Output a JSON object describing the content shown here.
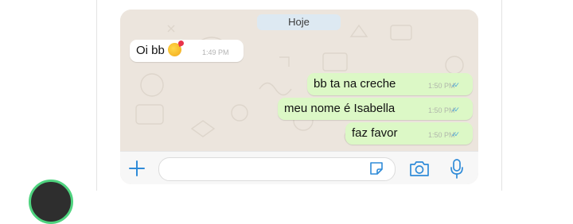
{
  "chat": {
    "date_separator": "Hoje",
    "messages": [
      {
        "direction": "incoming",
        "text": "Oi bb",
        "emoji": "smiling-face-with-hearts",
        "time": "1:49 PM",
        "read": false
      },
      {
        "direction": "outgoing",
        "text": "bb ta na creche",
        "time": "1:50 PM",
        "read": true
      },
      {
        "direction": "outgoing",
        "text": "meu nome é Isabella",
        "time": "1:50 PM",
        "read": true
      },
      {
        "direction": "outgoing",
        "text": "faz favor",
        "time": "1:50 PM",
        "read": true
      }
    ]
  },
  "composer": {
    "value": "",
    "placeholder": "",
    "icons": [
      "plus-icon",
      "sticker-icon",
      "camera-icon",
      "mic-icon"
    ]
  },
  "colors": {
    "chat_background": "#ece5dd",
    "incoming_bubble": "#ffffff",
    "outgoing_bubble": "#dcf8c6",
    "accent": "#2f8bd8",
    "read_ticks": "#4fa7d9"
  }
}
